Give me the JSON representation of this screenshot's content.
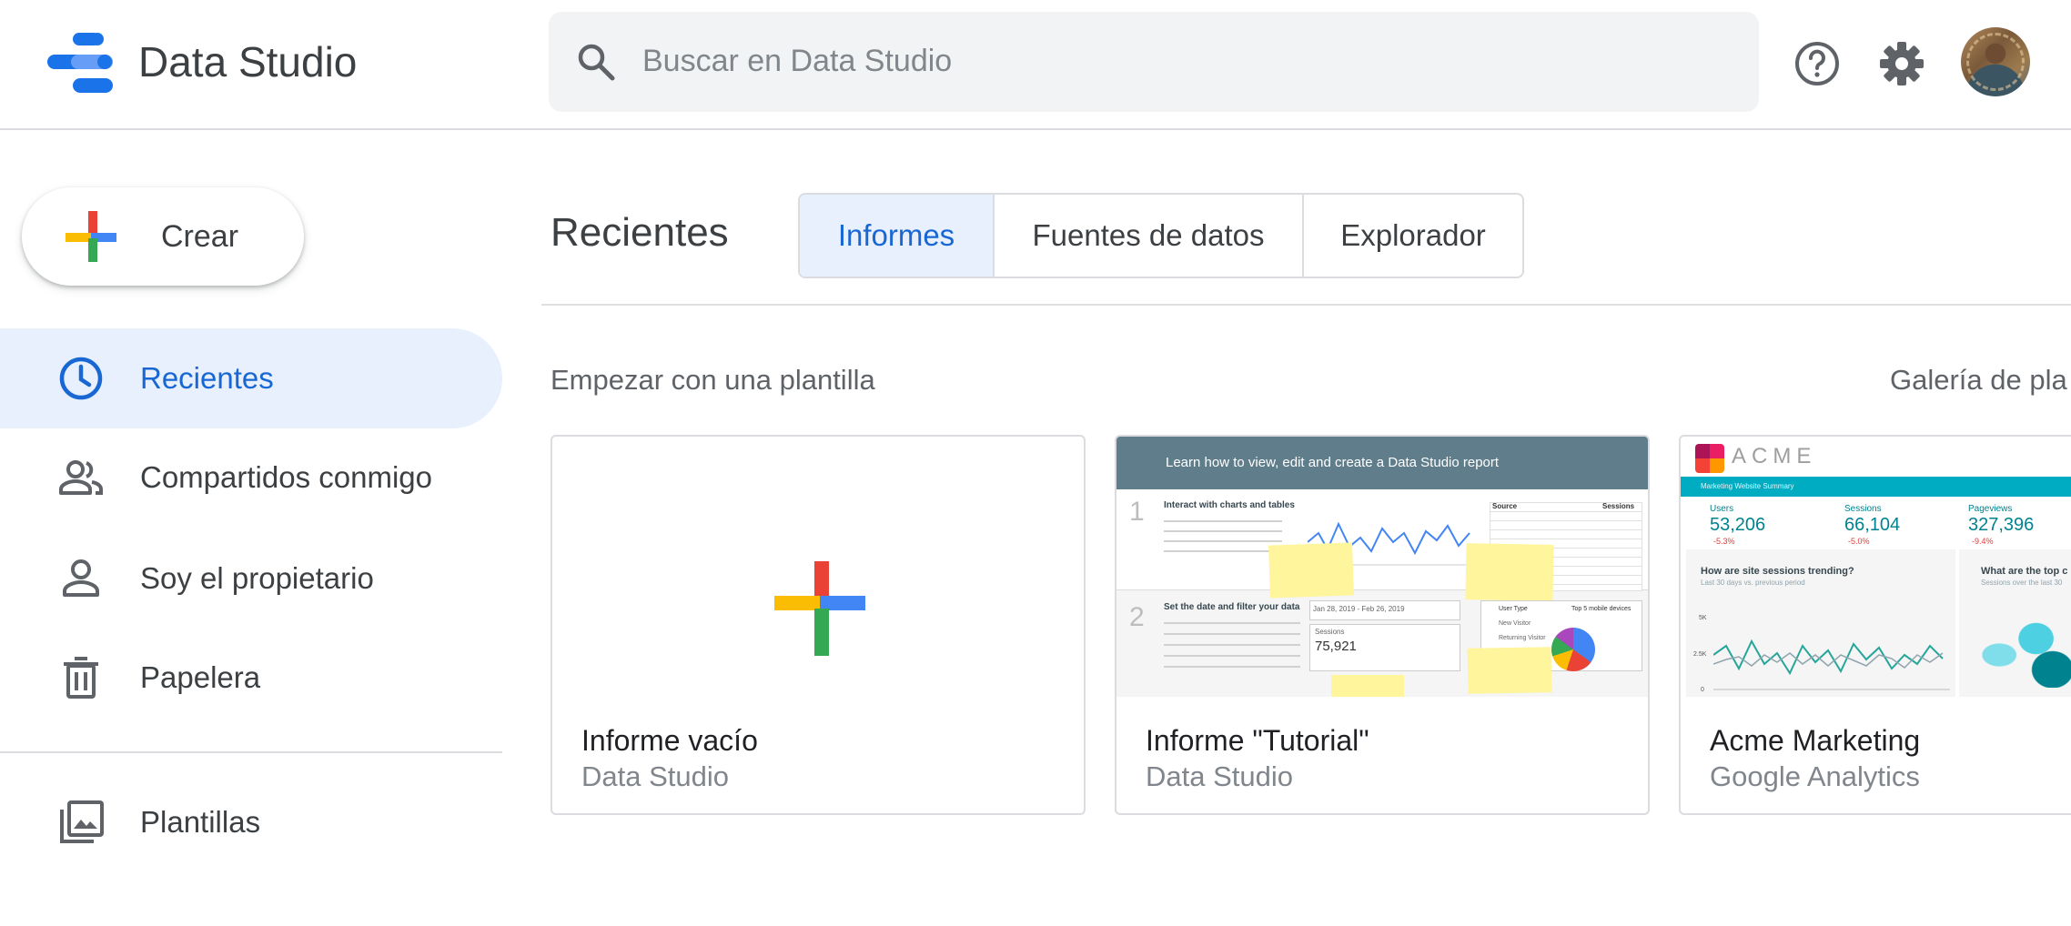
{
  "app": {
    "title": "Data Studio"
  },
  "search": {
    "placeholder": "Buscar en Data Studio"
  },
  "header_icons": [
    "help-icon",
    "settings-gear-icon",
    "user-avatar"
  ],
  "sidebar": {
    "create_label": "Crear",
    "items": [
      {
        "label": "Recientes",
        "icon": "clock-icon",
        "active": true
      },
      {
        "label": "Compartidos conmigo",
        "icon": "people-icon"
      },
      {
        "label": "Soy el propietario",
        "icon": "person-icon"
      },
      {
        "label": "Papelera",
        "icon": "trash-icon"
      },
      {
        "label": "Plantillas",
        "icon": "templates-icon"
      }
    ]
  },
  "main": {
    "section_title": "Recientes",
    "tabs": [
      {
        "label": "Informes",
        "active": true
      },
      {
        "label": "Fuentes de datos"
      },
      {
        "label": "Explorador"
      }
    ],
    "templates_heading": "Empezar con una plantilla",
    "gallery_link": "Galería de pla",
    "templates": [
      {
        "title": "Informe vacío",
        "subtitle": "Data Studio"
      },
      {
        "title": "Informe \"Tutorial\"",
        "subtitle": "Data Studio",
        "preview": {
          "header": "Learn how  to view, edit and create a Data Studio report",
          "step1_title": "Interact with charts and tables",
          "step2_title": "Set the date and filter your data",
          "date_range": "Jan 28, 2019 - Feb 26, 2019",
          "sessions_label": "Sessions",
          "sessions_value": "75,921",
          "table_headers": [
            "Source",
            "Sessions"
          ],
          "filter_title": "User Type",
          "filter_options": [
            "New Visitor",
            "Returning Visitor"
          ],
          "pie_title": "Top 5 mobile devices"
        }
      },
      {
        "title": "Acme Marketing",
        "subtitle": "Google Analytics",
        "preview": {
          "brand": "ACME",
          "banner": "Marketing Website Summary",
          "metrics": [
            {
              "label": "Users",
              "value": "53,206",
              "delta": "-5.3%"
            },
            {
              "label": "Sessions",
              "value": "66,104",
              "delta": "-5.0%"
            },
            {
              "label": "Pageviews",
              "value": "327,396",
              "delta": "-9.4%"
            }
          ],
          "q1": "How are site sessions trending?",
          "q1_sub": "Last 30 days vs. previous period",
          "q2": "What are the top c",
          "q2_sub": "Sessions over the last 30",
          "y_ticks": [
            "5K",
            "2.5K",
            "0"
          ]
        }
      }
    ]
  },
  "colors": {
    "accent_blue": "#1967d2",
    "active_bg": "#e8f0fe",
    "plus_red": "#ea4335",
    "plus_blue": "#4285f4",
    "plus_yellow": "#fbbc04",
    "plus_green": "#34a853"
  }
}
